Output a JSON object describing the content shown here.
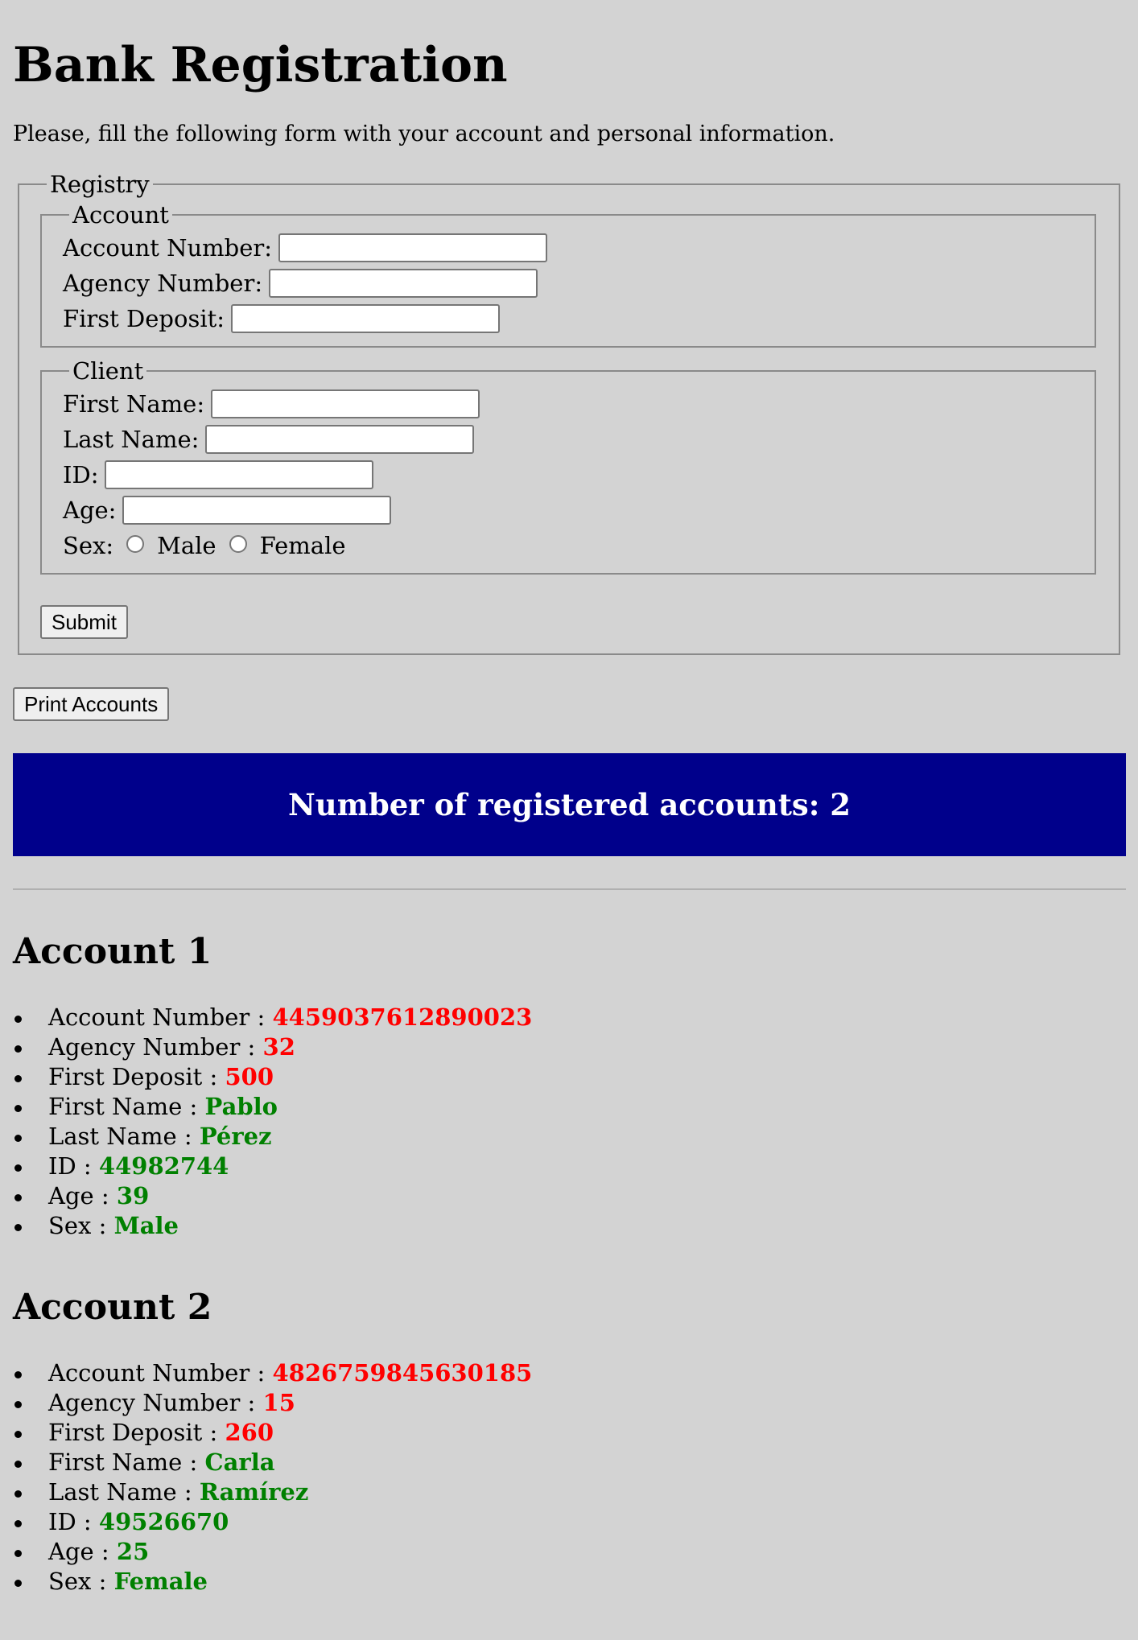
{
  "page": {
    "title": "Bank Registration",
    "intro": "Please, fill the following form with your account and personal information."
  },
  "form": {
    "legend": "Registry",
    "account": {
      "legend": "Account",
      "account_number_label": "Account Number:",
      "agency_number_label": "Agency Number:",
      "first_deposit_label": "First Deposit:"
    },
    "client": {
      "legend": "Client",
      "first_name_label": "First Name:",
      "last_name_label": "Last Name:",
      "id_label": "ID:",
      "age_label": "Age:",
      "sex_label": "Sex:",
      "male_label": "Male",
      "female_label": "Female"
    },
    "submit_label": "Submit"
  },
  "print_button_label": "Print Accounts",
  "banner": "Number of registered accounts: 2",
  "colors": {
    "background": "#d3d3d3",
    "banner": "#00008b",
    "account_value": "#ff0000",
    "client_value": "#008000"
  },
  "accounts": [
    {
      "heading": "Account 1",
      "fields": [
        {
          "label": "Account Number :",
          "value": "4459037612890023"
        },
        {
          "label": "Agency Number :",
          "value": "32"
        },
        {
          "label": "First Deposit :",
          "value": "500"
        },
        {
          "label": "First Name :",
          "value": "Pablo"
        },
        {
          "label": "Last Name :",
          "value": "Pérez"
        },
        {
          "label": "ID :",
          "value": "44982744"
        },
        {
          "label": "Age :",
          "value": "39"
        },
        {
          "label": "Sex :",
          "value": "Male"
        }
      ]
    },
    {
      "heading": "Account 2",
      "fields": [
        {
          "label": "Account Number :",
          "value": "4826759845630185"
        },
        {
          "label": "Agency Number :",
          "value": "15"
        },
        {
          "label": "First Deposit :",
          "value": "260"
        },
        {
          "label": "First Name :",
          "value": "Carla"
        },
        {
          "label": "Last Name :",
          "value": "Ramírez"
        },
        {
          "label": "ID :",
          "value": "49526670"
        },
        {
          "label": "Age :",
          "value": "25"
        },
        {
          "label": "Sex :",
          "value": "Female"
        }
      ]
    }
  ]
}
